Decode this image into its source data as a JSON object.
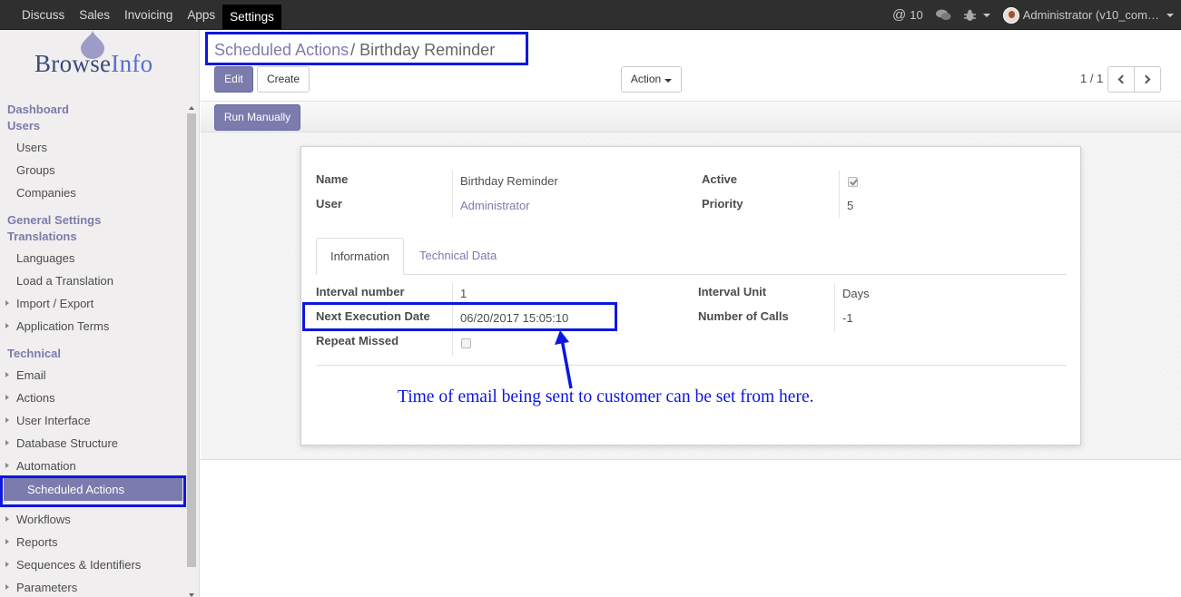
{
  "topbar": {
    "menu": [
      "Discuss",
      "Sales",
      "Invoicing",
      "Apps",
      "Settings"
    ],
    "active_menu": "Settings",
    "messages_count": "10",
    "user_label": "Administrator (v10_com…"
  },
  "logo": {
    "part1": "Browse",
    "part2": "Info"
  },
  "sidebar": {
    "dashboard": "Dashboard",
    "users_head": "Users",
    "users_items": [
      "Users",
      "Groups",
      "Companies"
    ],
    "general_settings": "General Settings",
    "translations": "Translations",
    "translation_items": [
      "Languages",
      "Load a Translation",
      "Import / Export",
      "Application Terms"
    ],
    "technical": "Technical",
    "technical_items": [
      "Email",
      "Actions",
      "User Interface",
      "Database Structure",
      "Automation"
    ],
    "active_item": "Scheduled Actions",
    "after_items": [
      "Workflows",
      "Reports",
      "Sequences & Identifiers",
      "Parameters"
    ]
  },
  "breadcrumb": {
    "parent": "Scheduled Actions",
    "separator": "/",
    "current": "Birthday Reminder"
  },
  "buttons": {
    "edit": "Edit",
    "create": "Create",
    "action": "Action",
    "run_manually": "Run Manually"
  },
  "pager": {
    "text": "1 / 1"
  },
  "form": {
    "name_label": "Name",
    "name_value": "Birthday Reminder",
    "user_label": "User",
    "user_value": "Administrator",
    "active_label": "Active",
    "active_checked": true,
    "priority_label": "Priority",
    "priority_value": "5",
    "tabs": [
      "Information",
      "Technical Data"
    ],
    "interval_number_label": "Interval number",
    "interval_number_value": "1",
    "next_exec_label": "Next Execution Date",
    "next_exec_value": "06/20/2017 15:05:10",
    "repeat_missed_label": "Repeat Missed",
    "repeat_missed_checked": false,
    "interval_unit_label": "Interval Unit",
    "interval_unit_value": "Days",
    "number_of_calls_label": "Number of Calls",
    "number_of_calls_value": "-1"
  },
  "annotation": {
    "text": "Time of email being sent to customer can be set from here."
  },
  "colors": {
    "accent": "#7c7bad",
    "highlight_box": "#0b17e0",
    "topbar": "#2f2f2f"
  }
}
